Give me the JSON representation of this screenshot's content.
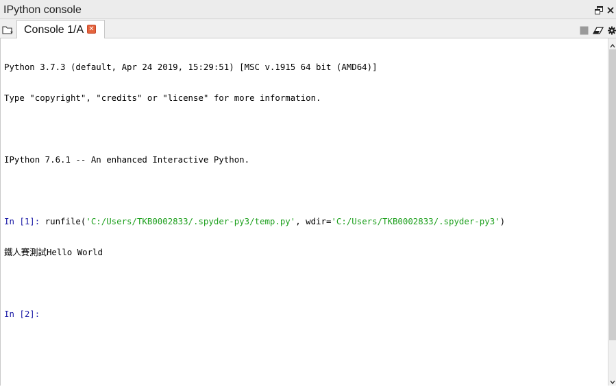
{
  "window": {
    "title": "IPython console",
    "title_icons": [
      "undock-icon",
      "close-icon"
    ]
  },
  "tabs": [
    {
      "label": "Console 1/A",
      "active": true
    }
  ],
  "toolbar": {
    "icons": [
      "stop-kernel-icon",
      "clear-console-icon",
      "options-gear-icon"
    ]
  },
  "console": {
    "banner": [
      "Python 3.7.3 (default, Apr 24 2019, 15:29:51) [MSC v.1915 64 bit (AMD64)]",
      "Type \"copyright\", \"credits\" or \"license\" for more information.",
      "IPython 7.6.1 -- An enhanced Interactive Python."
    ],
    "cell1": {
      "prompt": "In [1]:",
      "code_pre": " runfile(",
      "str1": "'C:/Users/TKB0002833/.spyder-py3/temp.py'",
      "code_mid": ", wdir=",
      "str2": "'C:/Users/TKB0002833/.spyder-py3'",
      "code_post": ")",
      "output": "鐵人賽測試Hello World"
    },
    "cell2": {
      "prompt": "In [2]:"
    }
  },
  "colors": {
    "prompt": "#1a1aa6",
    "string": "#1ea01e",
    "tab_close": "#e4643d"
  }
}
